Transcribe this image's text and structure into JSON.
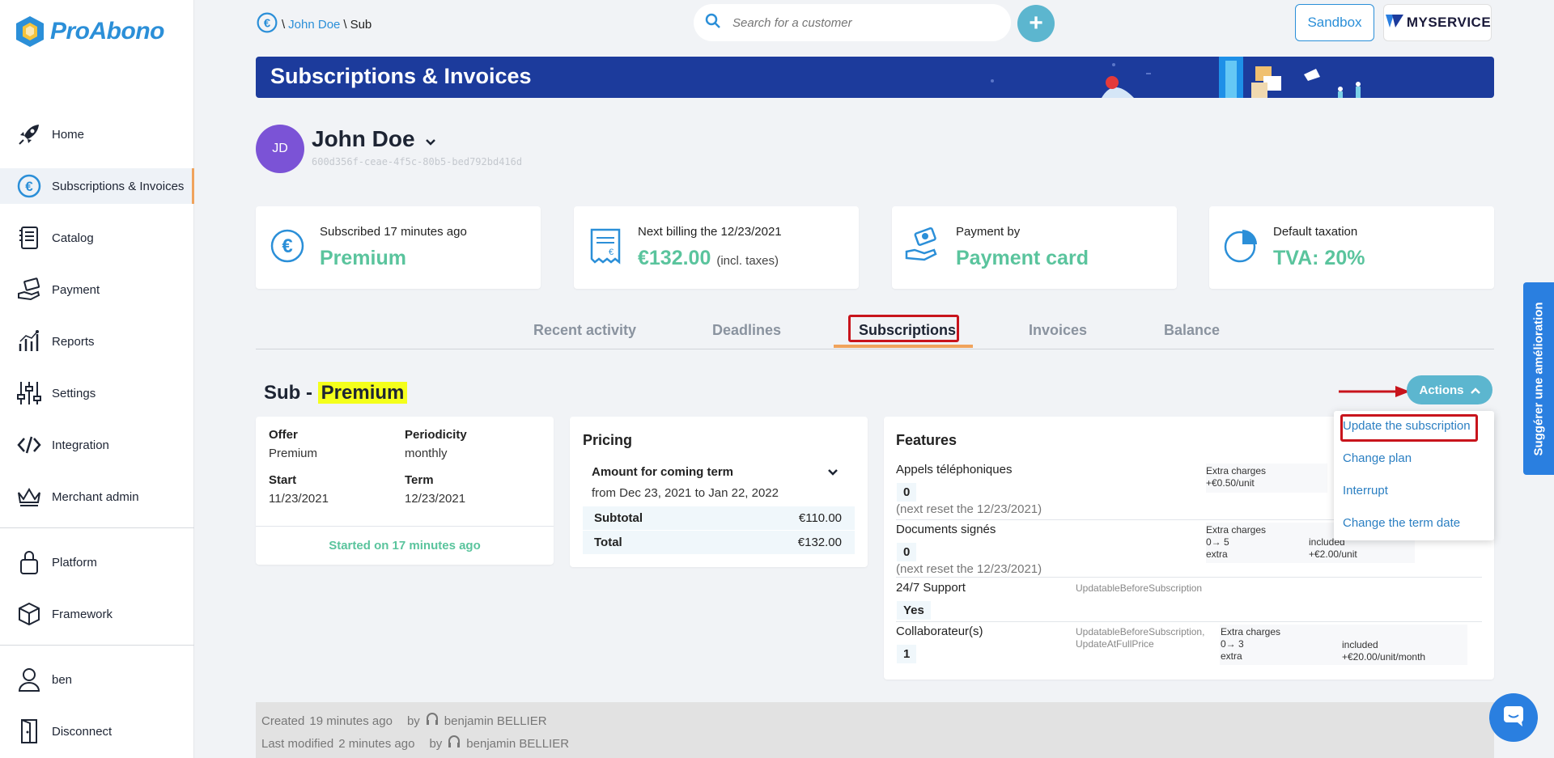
{
  "app": {
    "logo_text": "ProAbono"
  },
  "sidebar": {
    "items": [
      {
        "label": "Home",
        "icon": "rocket-icon"
      },
      {
        "label": "Subscriptions & Invoices",
        "icon": "euro-icon"
      },
      {
        "label": "Catalog",
        "icon": "catalog-icon"
      },
      {
        "label": "Payment",
        "icon": "payment-icon"
      },
      {
        "label": "Reports",
        "icon": "reports-icon"
      },
      {
        "label": "Settings",
        "icon": "settings-icon"
      },
      {
        "label": "Integration",
        "icon": "code-icon"
      },
      {
        "label": "Merchant admin",
        "icon": "crown-icon"
      },
      {
        "label": "Platform",
        "icon": "lock-icon"
      },
      {
        "label": "Framework",
        "icon": "box-icon"
      },
      {
        "label": "ben",
        "icon": "user-icon"
      },
      {
        "label": "Disconnect",
        "icon": "door-icon"
      }
    ]
  },
  "breadcrumb": {
    "customer": "John Doe",
    "current": "Sub",
    "sep": "\\"
  },
  "search": {
    "placeholder": "Search for a customer"
  },
  "header": {
    "sandbox_label": "Sandbox",
    "myservice_label": "MYSERVICE"
  },
  "banner": {
    "title": "Subscriptions & Invoices"
  },
  "customer": {
    "initials": "JD",
    "name": "John Doe",
    "id": "600d356f-ceae-4f5c-80b5-bed792bd416d"
  },
  "cards": [
    {
      "label": "Subscribed 17 minutes ago",
      "value": "Premium",
      "sub": ""
    },
    {
      "label": "Next billing the 12/23/2021",
      "value": "€132.00",
      "sub": "(incl. taxes)"
    },
    {
      "label": "Payment by",
      "value": "Payment card",
      "sub": ""
    },
    {
      "label": "Default taxation",
      "value": "TVA: 20%",
      "sub": ""
    }
  ],
  "tabs": [
    "Recent activity",
    "Deadlines",
    "Subscriptions",
    "Invoices",
    "Balance"
  ],
  "subscription": {
    "title_prefix": "Sub -",
    "title_highlight": "Premium",
    "actions_label": "Actions",
    "offer_label": "Offer",
    "offer_value": "Premium",
    "periodicity_label": "Periodicity",
    "periodicity_value": "monthly",
    "start_label": "Start",
    "start_value": "11/23/2021",
    "term_label": "Term",
    "term_value": "12/23/2021",
    "started_text": "Started on 17 minutes ago"
  },
  "pricing": {
    "title": "Pricing",
    "amount_label": "Amount for coming term",
    "period": "from Dec 23, 2021 to Jan 22, 2022",
    "subtotal_label": "Subtotal",
    "subtotal_value": "€110.00",
    "total_label": "Total",
    "total_value": "€132.00"
  },
  "features": {
    "title": "Features",
    "items": [
      {
        "name": "Appels téléphoniques",
        "value": "0",
        "reset": "(next reset the 12/23/2021)",
        "extra_title": "Extra charges",
        "extra_line": "+€0.50/unit"
      },
      {
        "name": "Documents signés",
        "value": "0",
        "reset": "(next reset the 12/23/2021)",
        "extra_title": "Extra charges",
        "range": "0→ 5",
        "range_label": "included",
        "extra_label": "extra",
        "extra_price": "+€2.00/unit"
      },
      {
        "name": "24/7 Support",
        "value": "Yes",
        "flag": "UpdatableBeforeSubscription"
      },
      {
        "name": "Collaborateur(s)",
        "value": "1",
        "flag1": "UpdatableBeforeSubscription,",
        "flag2": "UpdateAtFullPrice",
        "extra_title": "Extra charges",
        "range": "0→ 3",
        "range_label": "included",
        "extra_label": "extra",
        "extra_price": "+€20.00/unit/month"
      }
    ]
  },
  "actions_menu": [
    "Update the subscription",
    "Change plan",
    "Interrupt",
    "Change the term date"
  ],
  "footer": {
    "created_label": "Created",
    "created_time": "19 minutes ago",
    "by": "by",
    "created_by": "benjamin BELLIER",
    "modified_label": "Last modified",
    "modified_time": "2 minutes ago",
    "modified_by": "benjamin BELLIER"
  },
  "suggest_label": "Suggérer une amélioration",
  "colors": {
    "brand_blue": "#2b8fd8",
    "accent_teal": "#5cb6cf",
    "green": "#5ac49d",
    "banner": "#1c3b9c",
    "highlight": "#c8141c"
  }
}
